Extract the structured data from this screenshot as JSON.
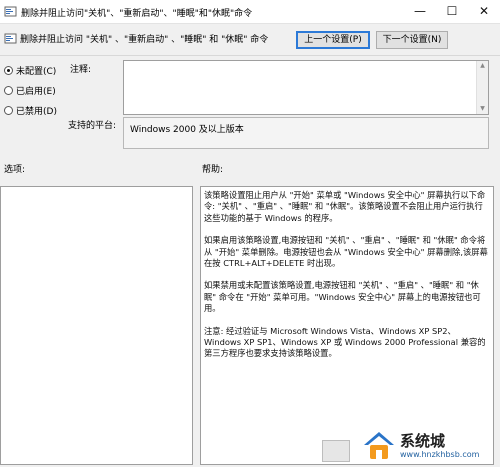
{
  "window": {
    "title": "删除并阻止访问\"关机\"、\"重新启动\"、\"睡眠\"和\"休眠\"命令",
    "minimize_glyph": "—",
    "maximize_glyph": "☐",
    "close_glyph": "✕"
  },
  "header": {
    "setting_title": "删除并阻止访问 \"关机\" 、\"重新启动\" 、\"睡眠\" 和 \"休眠\" 命令",
    "prev_button": "上一个设置(P)",
    "next_button": "下一个设置(N)"
  },
  "state": {
    "options": [
      {
        "label": "未配置(C)",
        "selected": true
      },
      {
        "label": "已启用(E)",
        "selected": false
      },
      {
        "label": "已禁用(D)",
        "selected": false
      }
    ]
  },
  "labels": {
    "comment": "注释:",
    "supported_on": "支持的平台:",
    "options": "选项:",
    "help": "帮助:"
  },
  "comment_value": "",
  "supported_on_value": "Windows 2000 及以上版本",
  "help_paragraphs": [
    "该策略设置阻止用户从 \"开始\" 菜单或 \"Windows 安全中心\" 屏幕执行以下命令: \"关机\" 、\"重启\" 、\"睡眠\" 和 \"休眠\"。该策略设置不会阻止用户运行执行这些功能的基于 Windows 的程序。",
    "如果启用该策略设置,电源按钮和 \"关机\" 、\"重启\" 、\"睡眠\" 和 \"休眠\" 命令将从 \"开始\" 菜单删除。电源按钮也会从 \"Windows 安全中心\" 屏幕删除,该屏幕在按 CTRL+ALT+DELETE 时出现。",
    "如果禁用或未配置该策略设置,电源按钮和 \"关机\" 、\"重启\" 、\"睡眠\" 和 \"休眠\" 命令在 \"开始\" 菜单可用。\"Windows 安全中心\" 屏幕上的电源按钮也可用。",
    "注意: 经过验证与 Microsoft Windows Vista、Windows XP SP2、Windows XP SP1、Windows XP 或 Windows 2000 Professional 兼容的第三方程序也要求支持该策略设置。"
  ],
  "watermark": {
    "title": "系统城",
    "url": "www.hnzkhbsb.com",
    "icon": "house-logo-icon"
  },
  "colors": {
    "accent_border": "#2b79d7",
    "watermark_orange": "#f39a1e",
    "watermark_blue": "#2a74c8"
  }
}
